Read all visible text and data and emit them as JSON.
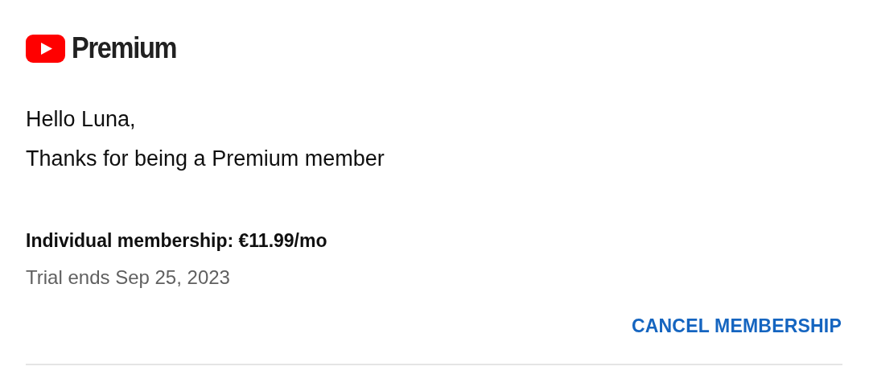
{
  "logo": {
    "text": "Premium"
  },
  "greeting": "Hello Luna,",
  "message": "Thanks for being a Premium member",
  "membership": {
    "plan": "Individual membership: €11.99/mo",
    "trial": "Trial ends Sep 25, 2023"
  },
  "buttons": [
    {
      "label": "CANCEL MEMBERSHIP"
    }
  ]
}
